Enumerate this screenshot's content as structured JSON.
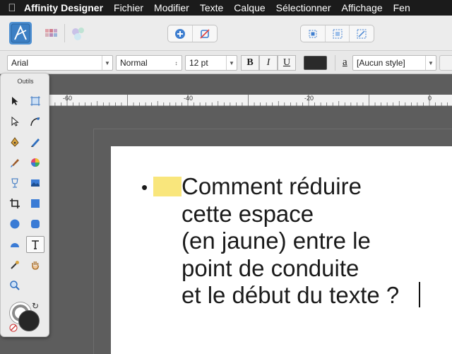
{
  "menubar": {
    "app_name": "Affinity Designer",
    "items": [
      "Fichier",
      "Modifier",
      "Texte",
      "Calque",
      "Sélectionner",
      "Affichage",
      "Fen"
    ]
  },
  "format_bar": {
    "font_family": "Arial",
    "font_style": "Normal",
    "font_size": "12 pt",
    "bold_label": "B",
    "italic_label": "I",
    "underline_label": "U",
    "text_color": "#2a2a2a",
    "style_icon_label": "a",
    "paragraph_style": "[Aucun style]"
  },
  "ruler": {
    "labels": [
      "-60",
      "-40",
      "-20",
      "0"
    ]
  },
  "tools_panel": {
    "title": "Outils"
  },
  "document": {
    "bullet_char": "•",
    "highlight_color": "#f9e67c",
    "lines": [
      "Comment réduire",
      "cette espace",
      "(en jaune) entre le",
      "point de conduite",
      "et le début du texte ?"
    ]
  }
}
